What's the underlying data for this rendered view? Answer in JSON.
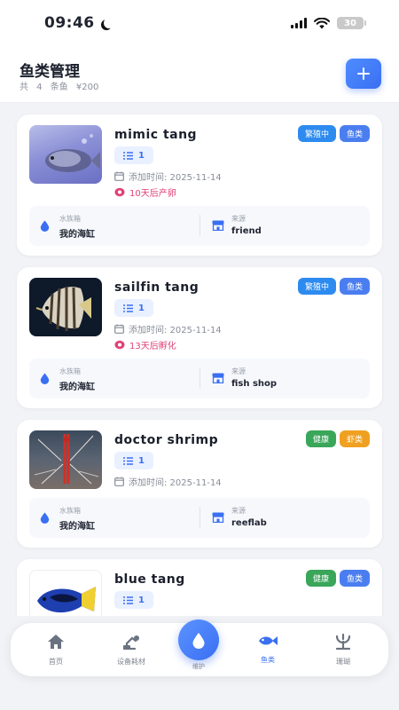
{
  "status_bar": {
    "time": "09:46",
    "battery": "30"
  },
  "header": {
    "title": "鱼类管理",
    "count": "共 4 条鱼",
    "price": "¥200"
  },
  "colors": {
    "accent": "#3a6ff2",
    "breeding": "#2d8bf0",
    "healthy": "#3aa65a",
    "fish_tag": "#4a7ef0",
    "shrimp_tag": "#f0a020",
    "event": "#e0427a"
  },
  "fish": [
    {
      "name": "mimic tang",
      "badges": [
        "繁殖中",
        "鱼类"
      ],
      "quantity": "1",
      "added": "添加时间: 2025-11-14",
      "event": "10天后产卵",
      "tank_label": "水族箱",
      "tank": "我的海缸",
      "source_label": "来源",
      "source": "friend"
    },
    {
      "name": "sailfin tang",
      "badges": [
        "繁殖中",
        "鱼类"
      ],
      "quantity": "1",
      "added": "添加时间: 2025-11-14",
      "event": "13天后孵化",
      "tank_label": "水族箱",
      "tank": "我的海缸",
      "source_label": "来源",
      "source": "fish shop"
    },
    {
      "name": "doctor shrimp",
      "badges": [
        "健康",
        "虾类"
      ],
      "quantity": "1",
      "added": "添加时间: 2025-11-14",
      "tank_label": "水族箱",
      "tank": "我的海缸",
      "source_label": "来源",
      "source": "reeflab"
    },
    {
      "name": "blue tang",
      "badges": [
        "健康",
        "鱼类"
      ],
      "quantity": "1"
    }
  ],
  "nav": {
    "home": "首页",
    "equipment": "设备耗材",
    "maintain": "维护",
    "fish": "鱼类",
    "coral": "珊瑚"
  }
}
